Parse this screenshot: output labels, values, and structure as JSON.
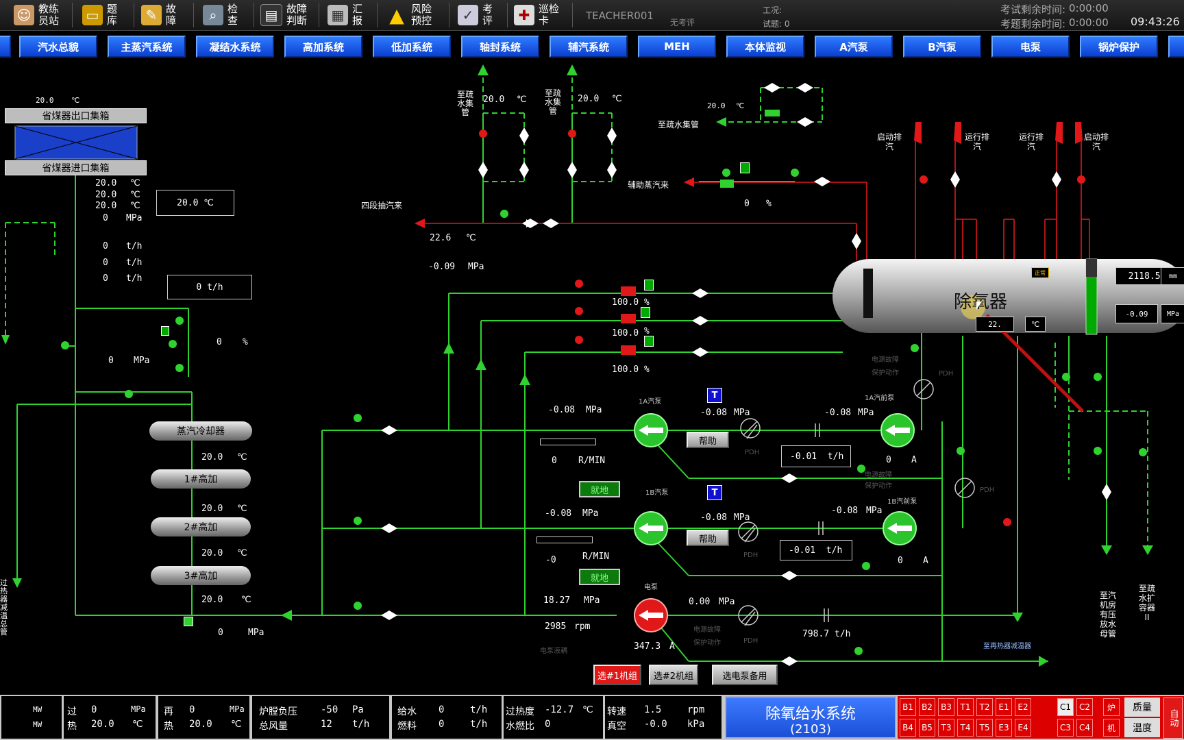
{
  "toolbar": {
    "buttons": [
      {
        "label": "教练\n员站",
        "icon": "person-icon"
      },
      {
        "label": "题\n库",
        "icon": "folder-icon"
      },
      {
        "label": "故\n障",
        "icon": "fault-icon"
      },
      {
        "label": "检\n查",
        "icon": "magnifier-icon"
      },
      {
        "label": "故障\n判断",
        "icon": "monitor-icon"
      },
      {
        "label": "汇\n报",
        "icon": "clipboard-icon"
      },
      {
        "label": "风险\n预控",
        "icon": "warning-icon"
      },
      {
        "label": "考\n评",
        "icon": "exam-icon"
      },
      {
        "label": "巡检\n卡",
        "icon": "inspection-card-icon"
      }
    ],
    "user": "TEACHER001",
    "eval_status": "无考评",
    "condition_label": "工况:",
    "trial_label": "试题: 0",
    "exam_remaining_label": "考试剩余时间:",
    "exam_remaining": "0:00:00",
    "question_remaining_label": "考题剩余时间:",
    "question_remaining": "0:00:00",
    "clock": "09:43:26"
  },
  "nav_tabs": [
    "汽水总貌",
    "主蒸汽系统",
    "凝结水系统",
    "高加系统",
    "低加系统",
    "轴封系统",
    "辅汽系统",
    "MEH",
    "本体监视",
    "A汽泵",
    "B汽泵",
    "电泵",
    "锅炉保护"
  ],
  "left": {
    "eco_outlet": "省煤器出口集箱",
    "eco_inlet": "省煤器进口集箱",
    "t_top": "20.0",
    "temps": [
      "20.0",
      "20.0",
      "20.0"
    ],
    "temp_box": "20.0  ℃",
    "pressure": "0",
    "flows": [
      "0",
      "0",
      "0"
    ],
    "flow_box": "0    t/h",
    "valve_pct": "0",
    "mpa_val": "0",
    "steam_cooler": "蒸汽冷却器",
    "hp1": "1#高加",
    "hp2": "2#高加",
    "hp3": "3#高加",
    "hp_temps": [
      "20.0",
      "20.0",
      "20.0",
      "20.0"
    ],
    "bottom_mpa": "0",
    "superheater_text": "过热器减温总管"
  },
  "center": {
    "drain_header": "至疏水集管",
    "drain1_temp": "20.0",
    "drain2_temp": "20.0",
    "drain3_temp": "20.0",
    "drain3_label": "至疏水集管",
    "aux_steam": "辅助蒸汽来",
    "aux_pct": "0",
    "stage4": "四段抽汽来",
    "stage4_temp": "22.6",
    "stage4_mpa": "-0.09",
    "valve_pcts": [
      "100.0",
      "100.0",
      "100.0"
    ],
    "pumpA": {
      "name": "1A汽泵",
      "mpa_in": "-0.08",
      "mpa_out": "-0.08",
      "rpm": "0",
      "help": "帮助",
      "local": "就地",
      "pre_name": "1A汽前泵",
      "pre_mpa": "-0.08",
      "flow": "-0.01",
      "amp": "0"
    },
    "pumpB": {
      "name": "1B汽泵",
      "mpa_in": "-0.08",
      "mpa_out": "-0.08",
      "rpm": "-0",
      "help": "帮助",
      "local": "就地",
      "pre_name": "1B汽前泵",
      "pre_mpa": "-0.08",
      "flow": "-0.01",
      "amp": "0"
    },
    "pumpE": {
      "name": "电泵",
      "mpa_out": "18.27",
      "rpm": "2985",
      "mpa2": "0.00",
      "amp": "347.3",
      "flow": "798.7"
    },
    "fault_text": "电源故障",
    "protect_text": "保护动作",
    "pdh": "PDH",
    "ep_text": "电泵液耦",
    "reheater_text": "至再热器减温器",
    "btn_unit1": "选#1机组",
    "btn_unit2": "选#2机组",
    "btn_epump": "选电泵备用"
  },
  "deaerator": {
    "name": "除氧器",
    "level": "2118.52",
    "level_unit": "mm",
    "pressure": "-0.09",
    "pressure_unit": "MPa",
    "temp": "22.",
    "temp_unit": "℃",
    "tag": "正常",
    "start_vent_l": "启动排汽",
    "run_vent_l": "运行排汽",
    "run_vent_r": "运行排汽",
    "start_vent_r": "启动排汽",
    "to_drain_room": "至汽机房有压放水母管",
    "to_expander": "至疏水扩容器II"
  },
  "status": {
    "mw_label": "MW",
    "sh_label1": "过",
    "sh_label2": "热",
    "sh_p": "0",
    "sh_t": "20.0",
    "rh_label1": "再",
    "rh_label2": "热",
    "rh_p": "0",
    "rh_t": "20.0",
    "furnace_label": "炉膛负压",
    "furnace_val": "-50",
    "furnace_unit": "Pa",
    "air_label": "总风量",
    "air_val": "12",
    "air_unit": "t/h",
    "fw_label": "给水",
    "fw_val": "0",
    "fw_unit": "t/h",
    "fuel_label": "燃料",
    "fuel_val": "0",
    "fuel_unit": "t/h",
    "superheat_label": "过热度",
    "superheat_val": "-12.7",
    "superheat_unit": "℃",
    "wf_label": "水燃比",
    "wf_val": "0",
    "speed_label": "转速",
    "speed_val": "1.5",
    "speed_unit": "rpm",
    "vac_label": "真空",
    "vac_val": "-0.0",
    "vac_unit": "kPa",
    "system_title": "除氧给水系统",
    "system_code": "(2103)",
    "alarm_row1": [
      "B1",
      "B2",
      "B3",
      "T1",
      "T2",
      "E1",
      "E2",
      "C1",
      "C2",
      "炉"
    ],
    "alarm_row2": [
      "B4",
      "B5",
      "T3",
      "T4",
      "T5",
      "E3",
      "E4",
      "C3",
      "C4",
      "机"
    ],
    "quality": "质量",
    "temperature": "温度",
    "auto": "自动",
    "unit_mpa": "MPa",
    "unit_c": "℃"
  },
  "units": {
    "c": "℃",
    "mpa": "MPa",
    "th": "t/h",
    "pct": "%",
    "rmin": "R/MIN",
    "a": "A",
    "rpm": "rpm"
  }
}
